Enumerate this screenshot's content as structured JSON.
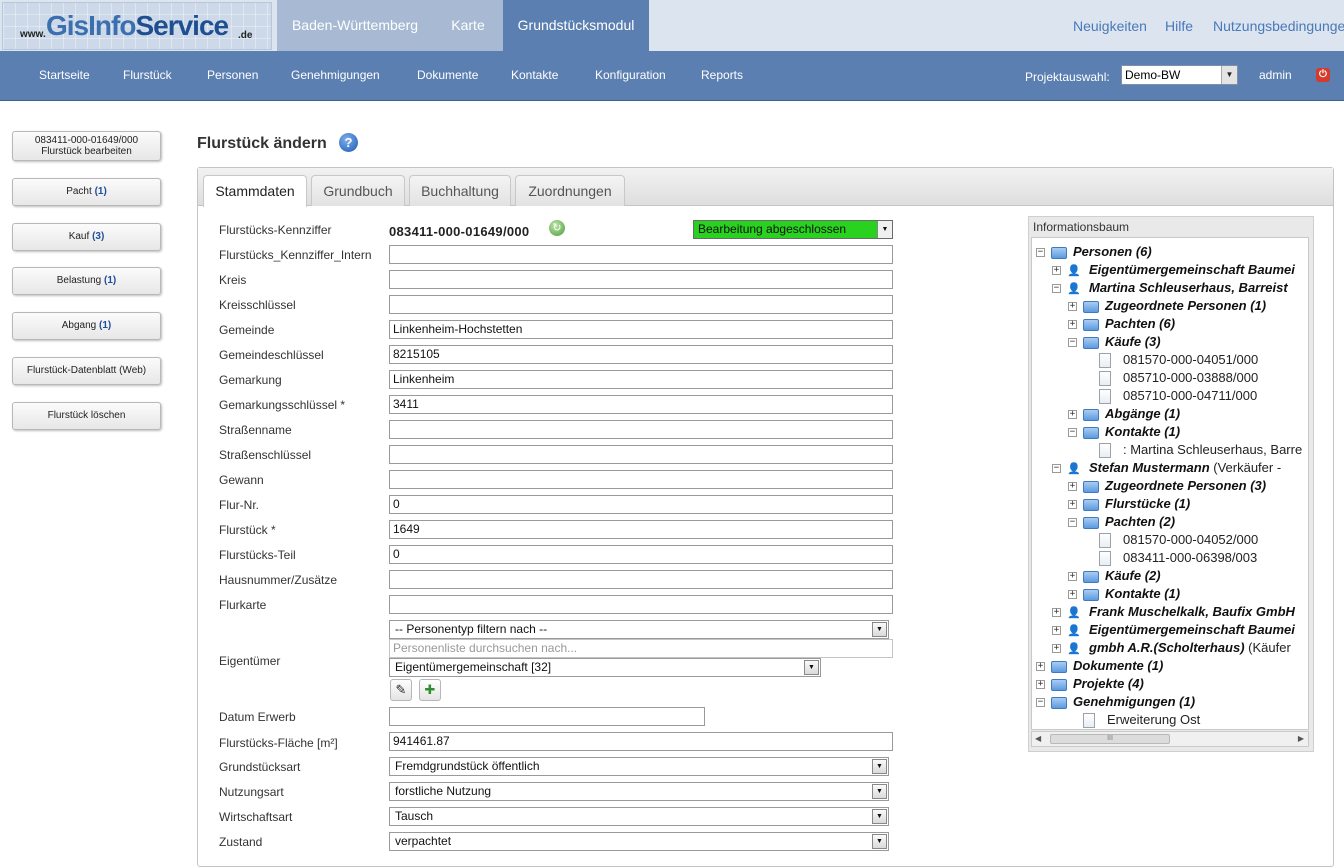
{
  "logo": {
    "www": "www.",
    "gis_light": "GisInfo",
    "gis_bold": "Service",
    "de": ".de"
  },
  "top_tabs": [
    "Baden-Württemberg",
    "Karte",
    "Grundstücksmodul"
  ],
  "top_links": [
    "Neuigkeiten",
    "Hilfe",
    "Nutzungsbedingungen"
  ],
  "nav": [
    "Startseite",
    "Flurstück",
    "Personen",
    "Genehmigungen",
    "Dokumente",
    "Kontakte",
    "Konfiguration",
    "Reports"
  ],
  "project": {
    "label": "Projektauswahl:",
    "value": "Demo-BW"
  },
  "user": "admin",
  "sidebar": {
    "edit_line1": "083411-000-01649/000",
    "edit_line2": "Flurstück bearbeiten",
    "items": [
      {
        "label": "Pacht",
        "count": "(1)"
      },
      {
        "label": "Kauf",
        "count": "(3)"
      },
      {
        "label": "Belastung",
        "count": "(1)"
      },
      {
        "label": "Abgang",
        "count": "(1)"
      }
    ],
    "datasheet": "Flurstück-Datenblatt (Web)",
    "delete": "Flurstück löschen"
  },
  "page_title": "Flurstück ändern",
  "tabs": [
    "Stammdaten",
    "Grundbuch",
    "Buchhaltung",
    "Zuordnungen"
  ],
  "form": {
    "kennziffer_label": "Flurstücks-Kennziffer",
    "kennziffer_value": "083411-000-01649/000",
    "status": "Bearbeitung abgeschlossen",
    "fields": [
      {
        "label": "Flurstücks_Kennziffer_Intern",
        "value": ""
      },
      {
        "label": "Kreis",
        "value": ""
      },
      {
        "label": "Kreisschlüssel",
        "value": ""
      },
      {
        "label": "Gemeinde",
        "value": "Linkenheim-Hochstetten"
      },
      {
        "label": "Gemeindeschlüssel",
        "value": "8215105"
      },
      {
        "label": "Gemarkung",
        "value": "Linkenheim"
      },
      {
        "label": "Gemarkungsschlüssel *",
        "value": "3411"
      },
      {
        "label": "Straßenname",
        "value": ""
      },
      {
        "label": "Straßenschlüssel",
        "value": ""
      },
      {
        "label": "Gewann",
        "value": ""
      },
      {
        "label": "Flur-Nr.",
        "value": "0"
      },
      {
        "label": "Flurstück *",
        "value": "1649"
      },
      {
        "label": "Flurstücks-Teil",
        "value": "0"
      },
      {
        "label": "Hausnummer/Zusätze",
        "value": ""
      },
      {
        "label": "Flurkarte",
        "value": ""
      }
    ],
    "owner": {
      "label": "Eigentümer",
      "filter": "-- Personentyp filtern nach --",
      "search_placeholder": "Personenliste durchsuchen nach...",
      "selected": "Eigentümergemeinschaft [32]"
    },
    "datum_label": "Datum Erwerb",
    "datum_value": "",
    "flaeche_label": "Flurstücks-Fläche [m²]",
    "flaeche_value": "941461.87",
    "selects": [
      {
        "label": "Grundstücksart",
        "value": "Fremdgrundstück öffentlich"
      },
      {
        "label": "Nutzungsart",
        "value": "forstliche Nutzung"
      },
      {
        "label": "Wirtschaftsart",
        "value": "Tausch"
      },
      {
        "label": "Zustand",
        "value": "verpachtet"
      }
    ]
  },
  "infotree": {
    "title": "Informationsbaum",
    "nodes": [
      {
        "pm": "−",
        "icon": "folder",
        "text": "Personen (6)",
        "bold": true,
        "sub": ""
      },
      {
        "pm": "+",
        "icon": "person",
        "text": "Eigentümergemeinschaft Baumei",
        "bold": true,
        "sub": ""
      },
      {
        "pm": "−",
        "icon": "person",
        "text": "Martina Schleuserhaus, Barreist",
        "bold": true,
        "sub": ""
      },
      {
        "pm": "+",
        "icon": "folder",
        "text": "Zugeordnete Personen (1)",
        "bold": true,
        "sub": ""
      },
      {
        "pm": "+",
        "icon": "folder",
        "text": "Pachten (6)",
        "bold": true,
        "sub": ""
      },
      {
        "pm": "−",
        "icon": "folder",
        "text": "Käufe (3)",
        "bold": true,
        "sub": ""
      },
      {
        "pm": "",
        "icon": "doc",
        "text": "081570-000-04051/000",
        "bold": false,
        "sub": ""
      },
      {
        "pm": "",
        "icon": "doc",
        "text": "085710-000-03888/000",
        "bold": false,
        "sub": ""
      },
      {
        "pm": "",
        "icon": "doc",
        "text": "085710-000-04711/000",
        "bold": false,
        "sub": ""
      },
      {
        "pm": "+",
        "icon": "folder",
        "text": "Abgänge (1)",
        "bold": true,
        "sub": ""
      },
      {
        "pm": "−",
        "icon": "folder",
        "text": "Kontakte (1)",
        "bold": true,
        "sub": ""
      },
      {
        "pm": "",
        "icon": "doc",
        "text": ": Martina Schleuserhaus, Barre",
        "bold": false,
        "sub": ""
      },
      {
        "pm": "−",
        "icon": "person",
        "text": "Stefan Mustermann",
        "bold": true,
        "sub": " (Verkäufer -"
      },
      {
        "pm": "+",
        "icon": "folder",
        "text": "Zugeordnete Personen (3)",
        "bold": true,
        "sub": ""
      },
      {
        "pm": "+",
        "icon": "folder",
        "text": "Flurstücke (1)",
        "bold": true,
        "sub": ""
      },
      {
        "pm": "−",
        "icon": "folder",
        "text": "Pachten (2)",
        "bold": true,
        "sub": ""
      },
      {
        "pm": "",
        "icon": "doc",
        "text": "081570-000-04052/000",
        "bold": false,
        "sub": ""
      },
      {
        "pm": "",
        "icon": "doc",
        "text": "083411-000-06398/003",
        "bold": false,
        "sub": ""
      },
      {
        "pm": "+",
        "icon": "folder",
        "text": "Käufe (2)",
        "bold": true,
        "sub": ""
      },
      {
        "pm": "+",
        "icon": "folder",
        "text": "Kontakte (1)",
        "bold": true,
        "sub": ""
      },
      {
        "pm": "+",
        "icon": "person",
        "text": "Frank Muschelkalk, Baufix GmbH",
        "bold": true,
        "sub": ""
      },
      {
        "pm": "+",
        "icon": "person",
        "text": "Eigentümergemeinschaft Baumei",
        "bold": true,
        "sub": ""
      },
      {
        "pm": "+",
        "icon": "person",
        "text": "gmbh A.R.(Scholterhaus)",
        "bold": true,
        "sub": " (Käufer"
      },
      {
        "pm": "+",
        "icon": "folder",
        "text": "Dokumente (1)",
        "bold": true,
        "sub": ""
      },
      {
        "pm": "+",
        "icon": "folder",
        "text": "Projekte (4)",
        "bold": true,
        "sub": ""
      },
      {
        "pm": "−",
        "icon": "folder",
        "text": "Genehmigungen (1)",
        "bold": true,
        "sub": ""
      },
      {
        "pm": "",
        "icon": "doc",
        "text": "Erweiterung Ost",
        "bold": false,
        "sub": ""
      }
    ],
    "scroll_thumb": "III"
  }
}
